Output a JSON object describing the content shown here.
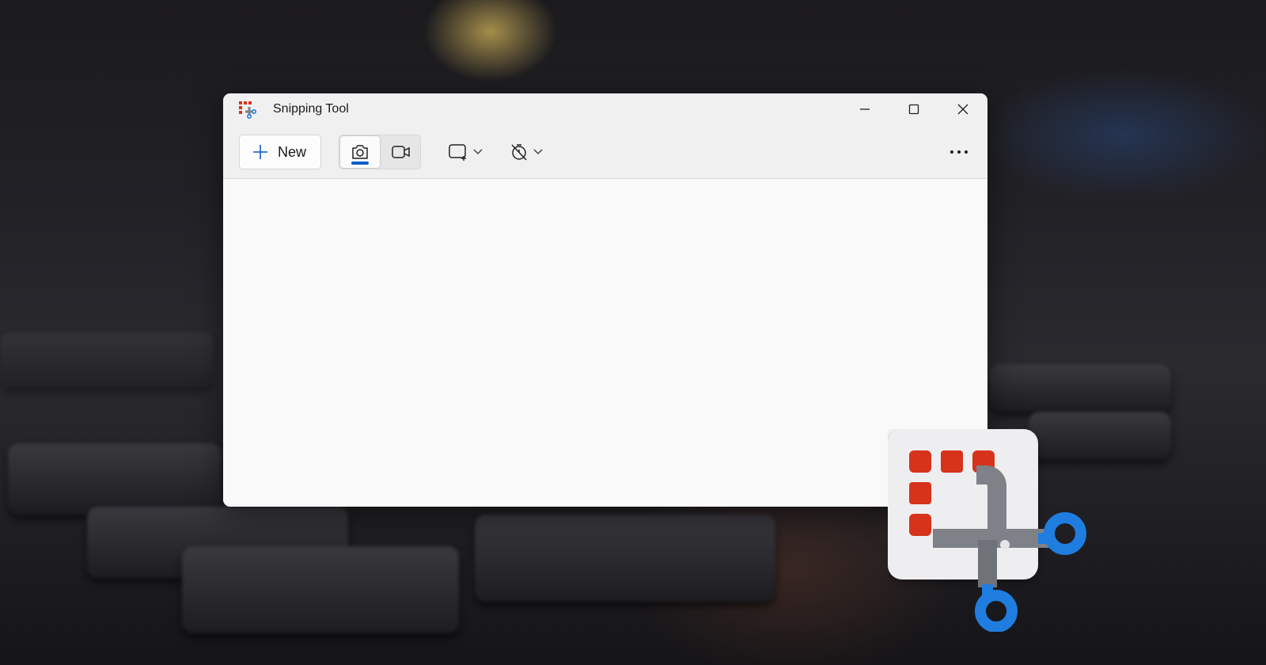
{
  "window": {
    "title": "Snipping Tool"
  },
  "toolbar": {
    "new_label": "New",
    "snip_mode": "snip-mode-screenshot",
    "more_label": "more-options"
  },
  "colors": {
    "accent": "#0b5cc7",
    "logo_red": "#d6331a",
    "logo_blue": "#1f7de0",
    "logo_gray": "#7e8188"
  }
}
